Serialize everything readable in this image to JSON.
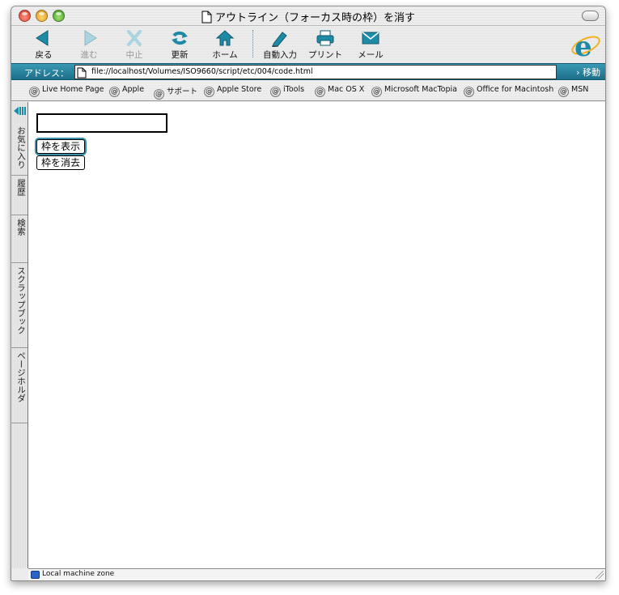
{
  "window": {
    "title": "アウトライン（フォーカス時の枠）を消す"
  },
  "toolbar": {
    "back": "戻る",
    "forward": "進む",
    "stop": "中止",
    "refresh": "更新",
    "home": "ホーム",
    "autofill": "自動入力",
    "print": "プリント",
    "mail": "メール"
  },
  "address": {
    "label": "アドレス：",
    "value": "file://localhost/Volumes/ISO9660/script/etc/004/code.html",
    "go": "移動"
  },
  "favorites": [
    "Live Home Page",
    "Apple",
    "サポート",
    "Apple Store",
    "iTools",
    "Mac OS X",
    "Microsoft MacTopia",
    "Office for Macintosh",
    "MSN"
  ],
  "sidebar": {
    "tabs": [
      "お気に入り",
      "履歴",
      "検索",
      "スクラップブック",
      "ページホルダ"
    ]
  },
  "page": {
    "input_value": "",
    "show_button": "枠を表示",
    "hide_button": "枠を消去"
  },
  "status": {
    "zone": "Local machine zone"
  },
  "colors": {
    "accent": "#1c6f88",
    "focus_ring": "#3c8fa8"
  }
}
